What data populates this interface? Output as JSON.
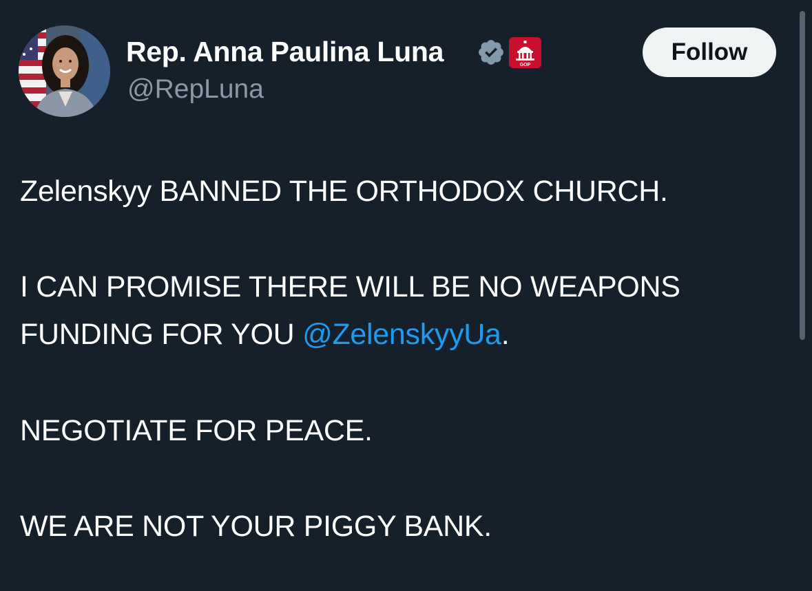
{
  "author": {
    "display_name": "Rep. Anna Paulina Luna",
    "handle": "@RepLuna",
    "verified_icon": "verified-badge-icon",
    "affiliation_icon": "house-gop-badge-icon",
    "affiliation_badge_text": "GOP"
  },
  "follow_button": {
    "label": "Follow"
  },
  "tweet": {
    "line1": "Zelenskyy BANNED THE ORTHODOX CHURCH.",
    "line2": "I CAN PROMISE THERE WILL BE NO WEAPONS",
    "line3_prefix": "FUNDING FOR YOU ",
    "mention": "@ZelenskyyUa",
    "line3_suffix": ".",
    "line4": "NEGOTIATE FOR PEACE.",
    "line5": "WE ARE NOT YOUR PIGGY BANK."
  },
  "colors": {
    "background": "#15202b",
    "text": "#ffffff",
    "secondary_text": "#8b98a5",
    "link": "#1d9bf0",
    "follow_button_bg": "#eff3f4",
    "gov_badge": "#c8102e"
  }
}
